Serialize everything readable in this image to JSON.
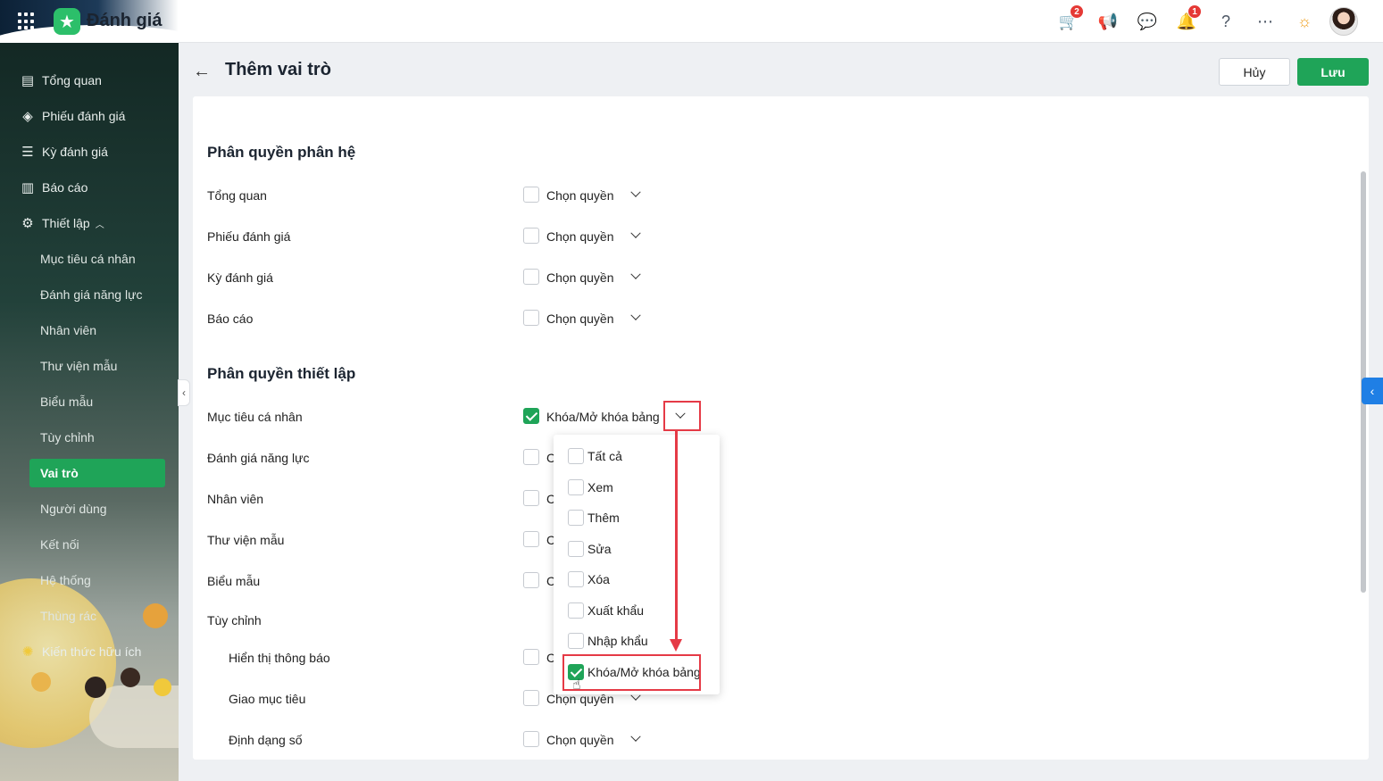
{
  "app": {
    "title": "Đánh giá"
  },
  "topbar": {
    "cart_badge": "2",
    "notification_badge": "1"
  },
  "sidebar": {
    "items": [
      {
        "label": "Tổng quan",
        "icon": "chart-line-icon"
      },
      {
        "label": "Phiếu đánh giá",
        "icon": "layers-icon"
      },
      {
        "label": "Kỳ đánh giá",
        "icon": "calendar-list-icon"
      },
      {
        "label": "Báo cáo",
        "icon": "bar-chart-icon"
      },
      {
        "label": "Thiết lập",
        "icon": "gear-icon"
      }
    ],
    "sub_items": [
      "Mục tiêu cá nhân",
      "Đánh giá năng lực",
      "Nhân viên",
      "Thư viện mẫu",
      "Biểu mẫu",
      "Tùy chỉnh",
      "Vai trò",
      "Người dùng",
      "Kết nối",
      "Hệ thống",
      "Thùng rác"
    ],
    "footer_item": "Kiến thức hữu ích",
    "active_sub": "Vai trò"
  },
  "header": {
    "title": "Thêm vai trò",
    "cancel_label": "Hủy",
    "save_label": "Lưu"
  },
  "sections": {
    "module_title": "Phân quyền phân hệ",
    "settings_title": "Phân quyền thiết lập"
  },
  "module_rows": [
    {
      "label": "Tổng quan",
      "value": "Chọn quyền"
    },
    {
      "label": "Phiếu đánh giá",
      "value": "Chọn quyền"
    },
    {
      "label": "Kỳ đánh giá",
      "value": "Chọn quyền"
    },
    {
      "label": "Báo cáo",
      "value": "Chọn quyền"
    }
  ],
  "settings_rows": [
    {
      "label": "Mục tiêu cá nhân",
      "value": "Khóa/Mở khóa bảng"
    },
    {
      "label": "Đánh giá năng lực",
      "value": "C"
    },
    {
      "label": "Nhân viên",
      "value": "C"
    },
    {
      "label": "Thư viện mẫu",
      "value": "C"
    },
    {
      "label": "Biểu mẫu",
      "value": "C"
    },
    {
      "label": "Tùy chỉnh"
    },
    {
      "label": "Hiển thị thông báo",
      "value": "C"
    },
    {
      "label": "Giao mục tiêu",
      "value": "Chọn quyền"
    },
    {
      "label": "Định dạng số",
      "value": "Chọn quyền"
    }
  ],
  "dropdown": {
    "options": [
      {
        "label": "Tất cả",
        "checked": false
      },
      {
        "label": "Xem",
        "checked": false
      },
      {
        "label": "Thêm",
        "checked": false
      },
      {
        "label": "Sửa",
        "checked": false
      },
      {
        "label": "Xóa",
        "checked": false
      },
      {
        "label": "Xuất khẩu",
        "checked": false
      },
      {
        "label": "Nhập khẩu",
        "checked": false
      },
      {
        "label": "Khóa/Mở khóa bảng",
        "checked": true
      }
    ]
  },
  "colors": {
    "accent": "#1fa458",
    "highlight": "#e53a46",
    "side_tab": "#1f7fe5"
  }
}
